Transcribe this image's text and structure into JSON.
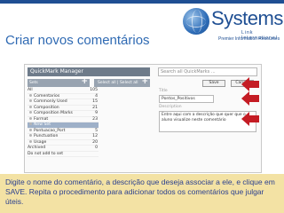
{
  "brand": {
    "name": "Systems",
    "tagline_1": "Link International",
    "tagline_2": "Premier Information Resources",
    "colors": {
      "brand_blue": "#1f4f93",
      "title_blue": "#2f6ab3",
      "caption_bg": "#f3e2a4",
      "arrow_red": "#c41c24"
    },
    "icon": "globe-icon"
  },
  "page": {
    "title": "Criar novos comentários"
  },
  "quickmark": {
    "window_title": "QuickMark Manager",
    "search_placeholder": "Search all QuickMarks ...",
    "left_strip_label": "Sets",
    "mid_strip_label": "Select all | Select all",
    "save_label": "Save",
    "cancel_label": "Cancel",
    "items": [
      {
        "label": "All",
        "count": "105"
      },
      {
        "label": "Comentarios",
        "count": "4"
      },
      {
        "label": "Commonly Used",
        "count": "15"
      },
      {
        "label": "Composition",
        "count": "21"
      },
      {
        "label": "Composition Marks",
        "count": "9"
      },
      {
        "label": "Format",
        "count": "23"
      },
      {
        "label": "New Set",
        "count": ""
      },
      {
        "label": "Pontuacao_Port",
        "count": "5"
      },
      {
        "label": "Punctuation",
        "count": "12"
      },
      {
        "label": "Usage",
        "count": "20"
      },
      {
        "label": "Archived",
        "count": "0"
      },
      {
        "label": "Do not add to set",
        "count": ""
      }
    ],
    "form": {
      "title_label": "Title",
      "title_value": "Pontos_Positivos",
      "description_label": "Description",
      "description_value": "Entre aqui com a descrição que quer que o aluno visualize neste comentário"
    }
  },
  "caption": {
    "text": "Digite o nome do comentário, a descrição que deseja associar a ele, e clique em SAVE. Repita o procedimento para adicionar todos os comentários que julgar úteis."
  }
}
